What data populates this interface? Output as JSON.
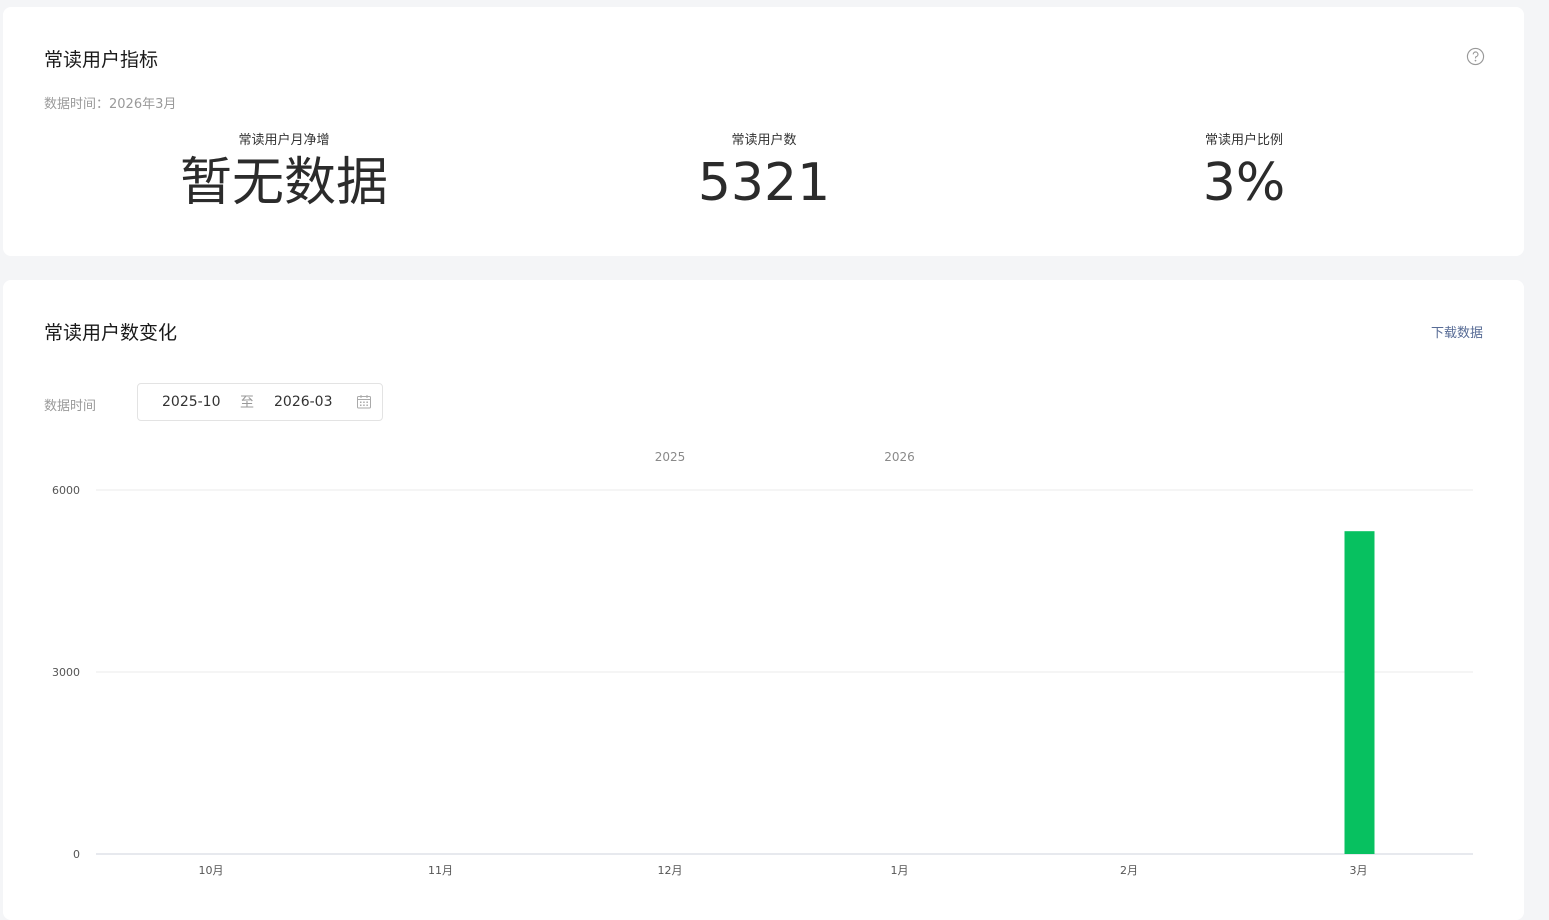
{
  "metrics_card": {
    "title": "常读用户指标",
    "data_time": "数据时间：2026年3月",
    "items": [
      {
        "label": "常读用户月净增",
        "value": "暂无数据"
      },
      {
        "label": "常读用户数",
        "value": "5321"
      },
      {
        "label": "常读用户比例",
        "value": "3%"
      }
    ]
  },
  "trend_card": {
    "title": "常读用户数变化",
    "download_label": "下载数据",
    "filter_label": "数据时间",
    "date_start": "2025-10",
    "date_separator": "至",
    "date_end": "2026-03"
  },
  "colors": {
    "bar": "#07c160",
    "link": "#576b95"
  },
  "chart_data": {
    "type": "bar",
    "categories": [
      "10月",
      "11月",
      "12月",
      "1月",
      "2月",
      "3月"
    ],
    "year_labels": [
      {
        "label": "2025",
        "after_category": "12月"
      },
      {
        "label": "2026",
        "at_category": "1月"
      }
    ],
    "values": [
      0,
      0,
      0,
      0,
      0,
      5321
    ],
    "ylim": [
      0,
      6000
    ],
    "yticks": [
      0,
      3000,
      6000
    ],
    "grid": true,
    "title": "",
    "xlabel": "",
    "ylabel": ""
  }
}
